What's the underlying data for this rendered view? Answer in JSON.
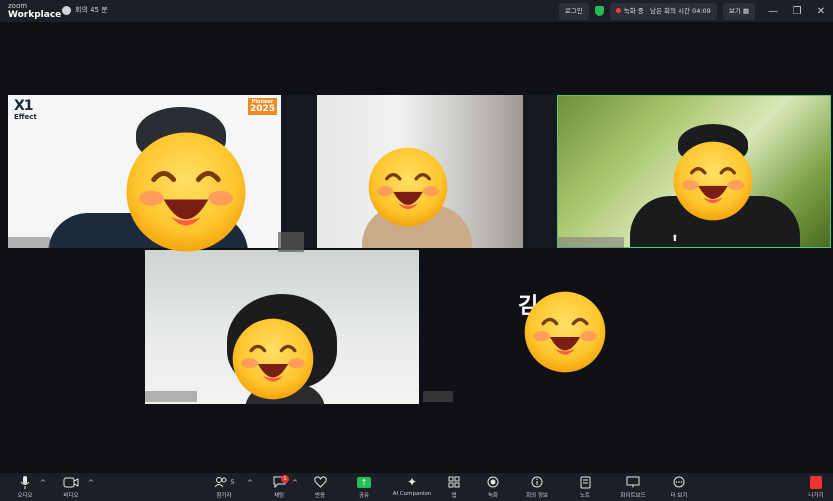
{
  "titlebar": {
    "brand_small": "zoom",
    "brand_big": "Workplace",
    "meeting_title": "회의 45 분",
    "login": "로그인",
    "recording": "녹화 중",
    "time_left": "남은 회의 시간 04:09",
    "view": "보기"
  },
  "tiles": {
    "logo_x1": "X1",
    "logo_effect": "Effect",
    "badge_small": "Pioneer",
    "badge_year": "2025",
    "big_letter": "김"
  },
  "toolbar": {
    "audio": "오디오",
    "video": "비디오",
    "participants": "참가자",
    "participants_count": "5",
    "chat": "채팅",
    "chat_badge": "1",
    "reactions": "반응",
    "share": "공유",
    "ai_companion": "AI Companion",
    "apps": "앱",
    "record": "녹화",
    "meeting_info": "회의 정보",
    "notes": "노트",
    "whiteboard": "화이트보드",
    "more": "더 보기",
    "leave": "나가기"
  },
  "colors": {
    "accent_green": "#1fbf5a",
    "active_border": "#3fd07a",
    "record_red": "#ff3b3b"
  }
}
